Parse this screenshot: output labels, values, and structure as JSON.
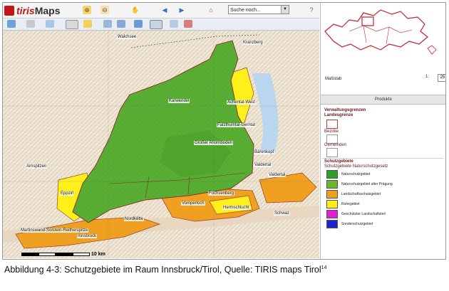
{
  "app": {
    "logo_a": "tiris",
    "logo_b": "Maps"
  },
  "search": {
    "value": "Suche noch..."
  },
  "map": {
    "labels": [
      "Kranzberg",
      "Karwendel",
      "Achental-West",
      "Falzthurntal-Gerntal",
      "Großer Ahornboden",
      "Bärenkopf",
      "Valdertal",
      "Arnspitzen",
      "Eppzirl",
      "Martinswand-Solstein-Reitherspitze",
      "Nordkette",
      "Vomperloch",
      "Fuchsenberg",
      "Hermschlucht",
      "Valdertal",
      "Schwaz",
      "Innsbruck",
      "Walchsee"
    ],
    "scale_label": "10 km"
  },
  "panel": {
    "massstab_label": "Maßstab",
    "massstab_value": "1:",
    "massstab_input": "25",
    "produkte_label": "Produkte",
    "verwaltungsgrenzen": "Verwaltungsgrenzen",
    "landesgrenze": "Landesgrenze",
    "bezirke": "Bezirke",
    "gemeinden": "Gemeinden",
    "schutzgebiete": "Schutzgebiete",
    "schutzgebiete_sub": "Schutzgebiete Naturschutzgesetz",
    "legend": [
      {
        "label": "Naturschutzgebiet",
        "color": "#2e9e2e"
      },
      {
        "label": "Naturschutzgebiet alter Prägung",
        "color": "#66b92b"
      },
      {
        "label": "Landschaftsschutzgebiet",
        "color": "#f0a020"
      },
      {
        "label": "Ruhegebiet",
        "color": "#ffef1a"
      },
      {
        "label": "Geschützter Landschaftsteil",
        "color": "#e01fd0"
      },
      {
        "label": "Sonderschutzgebiet",
        "color": "#2222cc"
      }
    ]
  },
  "caption": {
    "text": "Abbildung 4-3: Schutzgebiete im Raum Innsbruck/Tirol, Quelle: TIRIS maps Tirol",
    "footnote": "14"
  }
}
